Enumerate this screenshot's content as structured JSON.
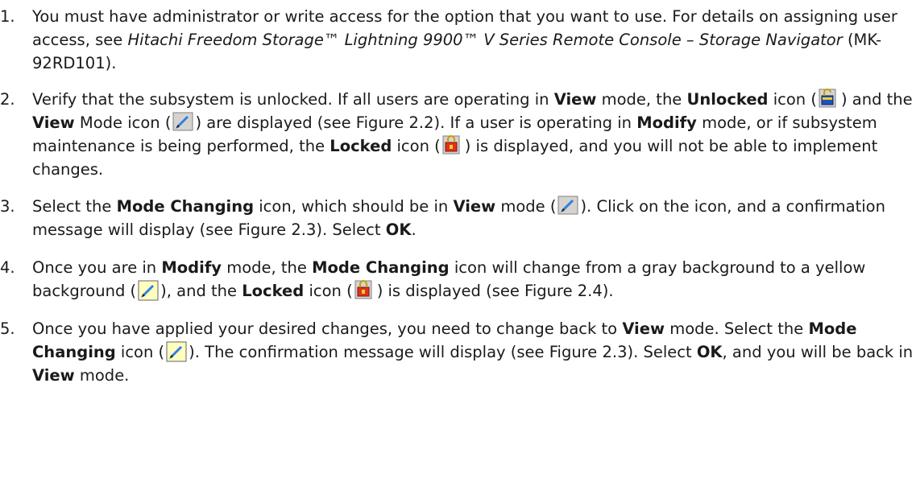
{
  "steps": [
    {
      "num": "1.",
      "t1": "You must have administrator or write access for the option that you want to use. For details on assigning user access, see ",
      "italic": "Hitachi Freedom Storage™ Lightning 9900™ V Series Remote Console – Storage Navigator",
      "t2": " (MK-92RD101)."
    },
    {
      "num": "2.",
      "t1": "Verify that the subsystem is unlocked. If all users are operating in ",
      "b1": "View",
      "t2": " mode, the ",
      "b2": "Unlocked",
      "t3": " icon (",
      "t4": ") and the ",
      "b3": "View",
      "t5": " Mode icon (",
      "t6": ") are displayed (see Figure 2.2). If a user is operating in ",
      "b4": "Modify",
      "t7": " mode, or if subsystem maintenance is being performed, the ",
      "b5": "Locked",
      "t8": " icon (",
      "t9": ") is displayed, and you will not be able to implement changes."
    },
    {
      "num": "3.",
      "t1": "Select the ",
      "b1": "Mode Changing",
      "t2": " icon, which should be in ",
      "b2": "View",
      "t3": " mode (",
      "t4": "). Click on the icon, and a confirmation message will display (see Figure 2.3). Select ",
      "b3": "OK",
      "t5": "."
    },
    {
      "num": "4.",
      "t1": "Once you are in ",
      "b1": "Modify",
      "t2": " mode, the ",
      "b2": "Mode Changing",
      "t3": " icon will change from a gray background to a yellow background (",
      "t4": "), and the ",
      "b3": "Locked",
      "t5": " icon (",
      "t6": ") is displayed (see Figure 2.4)."
    },
    {
      "num": "5.",
      "t1": "Once you have applied your desired changes, you need to change back to ",
      "b1": "View",
      "t2": " mode. Select the ",
      "b2": "Mode Changing",
      "t3": " icon (",
      "t4": "). The confirmation message will display (see Figure 2.3). Select ",
      "b3": "OK",
      "t5": ", and you will be back in ",
      "b4": "View",
      "t6": " mode."
    }
  ],
  "icons": {
    "unlocked": "unlocked-icon",
    "view_mode": "view-mode-icon",
    "locked": "locked-icon",
    "modify_mode": "modify-mode-icon"
  },
  "colors": {
    "text": "#1a1a1a",
    "view_bg": "#d6d3ce",
    "modify_bg": "#ffffc0",
    "lock_red": "#e03020",
    "unlock_blue": "#2050c0",
    "pen_blue": "#3080e0"
  }
}
